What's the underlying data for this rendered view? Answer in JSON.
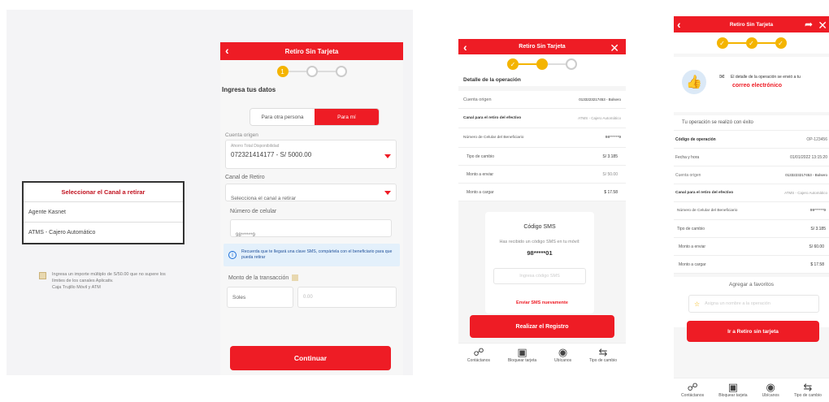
{
  "canal_dialog": {
    "title": "Seleccionar el Canal a retirar",
    "options": [
      "Agente Kasnet",
      "ATMS - Cajero Automático"
    ],
    "note_line1": "Ingresa un importe múltiplo de S/50.00 que no supere los",
    "note_line2": "límites de los canales Aplicativ.",
    "note_line3": "Caja Trujillo Móvil y ATM"
  },
  "screen1": {
    "title": "Retiro Sin Tarjeta",
    "steps": [
      "1",
      "2",
      "3"
    ],
    "section": "Ingresa tus datos",
    "tab_other": "Para otra persona",
    "tab_me": "Para mí",
    "origin_label": "Cuenta origen",
    "origin_sub": "Ahorro Total Disponibilidad",
    "origin_value": "072321414177 - S/ 5000.00",
    "channel_label": "Canal de Retiro",
    "channel_placeholder": "Selecciona el canal a retirar",
    "phone_label": "Número de celular",
    "phone_value": "98******9",
    "info_text": "Recuerda que te llegará una clave SMS, compártela con el beneficiario para que pueda retirar",
    "amount_label": "Monto de la transacción",
    "currency": "Soles",
    "amount_placeholder": "0.00",
    "continue": "Continuar"
  },
  "screen2": {
    "title": "Retiro Sin Tarjeta",
    "section": "Detalle de la operación",
    "rows": [
      {
        "label": "Cuenta origen",
        "value": "0133223217453 - Bolsero"
      },
      {
        "label": "Canal para el retiro del efectivo",
        "value": "ATMS - Cajero Automático"
      },
      {
        "label": "Número de Celular del Beneficiario",
        "value": "98******9"
      },
      {
        "label": "Tipo de cambio",
        "value": "S/ 3.185"
      },
      {
        "label": "Monto a enviar",
        "value": "S/ 50.00"
      },
      {
        "label": "Monto a cargar",
        "value": "$ 17.58"
      }
    ],
    "sms_title": "Código SMS",
    "sms_text": "Has recibido un código SMS en tu móvil:",
    "sms_number": "98*****01",
    "sms_placeholder": "Ingresa código SMS",
    "resend": "Enviar SMS nuevamente",
    "submit": "Realizar el Registro",
    "nav": [
      "Contáctanos",
      "Bloquear tarjeta",
      "Ubícanos",
      "Tipo de cambio"
    ]
  },
  "screen3": {
    "title": "Retiro Sin Tarjeta",
    "email_line": "El detalle de la operación se envió a tu",
    "email_word": "correo electrónico",
    "success": "Tu operación se realizó con éxito",
    "rows": [
      {
        "label": "Código de operación",
        "value": "OP-123456"
      },
      {
        "label": "Fecha y hora",
        "value": "01/01/2022 13:15:20"
      },
      {
        "label": "Cuenta origen",
        "value": "0133223217453 - Bolsero"
      },
      {
        "label": "Canal para el retiro del efectivo",
        "value": "ATMS - Cajero Automático"
      },
      {
        "label": "Número de Celular del Beneficiario",
        "value": "99******9"
      },
      {
        "label": "Tipo de cambio",
        "value": "S/ 3.185"
      },
      {
        "label": "Monto a enviar",
        "value": "S/ 60.00"
      },
      {
        "label": "Monto a cargar",
        "value": "$ 17.58"
      }
    ],
    "fav_title": "Agregar a favoritos",
    "fav_placeholder": "Asigna un nombre a la operación",
    "button": "Ir a Retiro sin tarjeta",
    "nav": [
      "Contáctanos",
      "Bloquear tarjeta",
      "Ubícanos",
      "Tipo de cambio"
    ]
  },
  "colors": {
    "accent": "#ee1c25",
    "step": "#f4b400",
    "info": "#e3f0fb"
  }
}
